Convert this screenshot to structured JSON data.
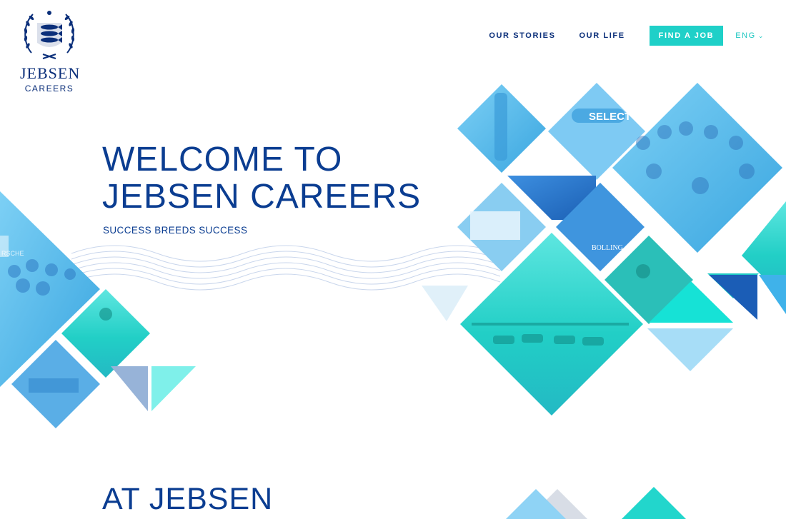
{
  "logo": {
    "brand": "JEBSEN",
    "sub": "CAREERS"
  },
  "nav": {
    "items": [
      {
        "label": "OUR STORIES"
      },
      {
        "label": "OUR LIFE"
      }
    ],
    "cta": "FIND A JOB",
    "lang": "ENG"
  },
  "hero": {
    "title_line1": "WELCOME TO",
    "title_line2": "JEBSEN CAREERS",
    "subtitle": "SUCCESS BREEDS SUCCESS"
  },
  "section": {
    "title": "AT JEBSEN"
  },
  "photo_labels": {
    "store": "SELECT",
    "bottle": "BOLLING",
    "porsche": "RSCHE"
  },
  "colors": {
    "navy": "#0b3d91",
    "teal": "#1fd0c8",
    "sky": "#4fb3e8",
    "aqua": "#22d8cf"
  }
}
